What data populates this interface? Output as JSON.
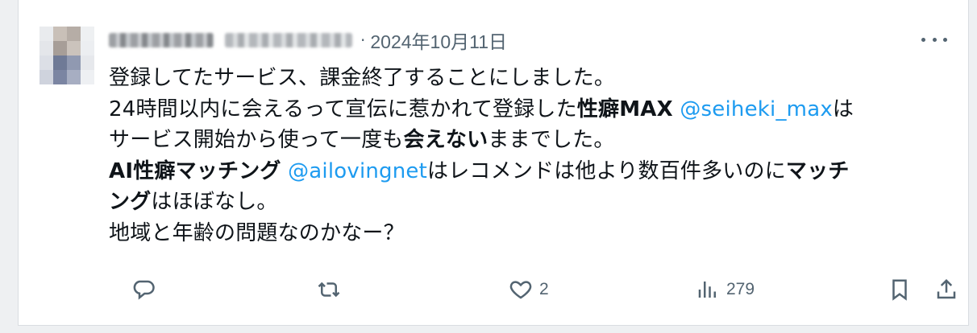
{
  "tweet": {
    "date": "2024年10月11日",
    "dot": "·",
    "lines": {
      "l1": "登録してたサービス、課金終了することにしました。",
      "l2a": "24時間以内に会えるって宣伝に惹かれて登録した",
      "l2b": "性癖MAX",
      "l2c": " ",
      "l2d": "@seiheki_max",
      "l2e": "は",
      "l3a": "サービス開始から使って一度も",
      "l3b": "会えない",
      "l3c": "ままでした。",
      "l4a": "AI性癖マッチング",
      "l4b": " ",
      "l4c": "@ailovingnet",
      "l4d": "はレコメンドは他より数百件多いのに",
      "l4e": "マッチ",
      "l5a": "ング",
      "l5b": "はほぼなし。",
      "l6": "地域と年齢の問題なのかなー？"
    }
  },
  "actions": {
    "reply": {
      "icon": "reply-icon",
      "count": ""
    },
    "retweet": {
      "icon": "retweet-icon",
      "count": ""
    },
    "like": {
      "icon": "heart-icon",
      "count": "2"
    },
    "views": {
      "icon": "views-icon",
      "count": "279"
    },
    "bookmark": {
      "icon": "bookmark-icon"
    },
    "share": {
      "icon": "share-icon"
    }
  },
  "colors": {
    "text": "#0f1419",
    "muted": "#536471",
    "mention": "#1d9bf0"
  }
}
